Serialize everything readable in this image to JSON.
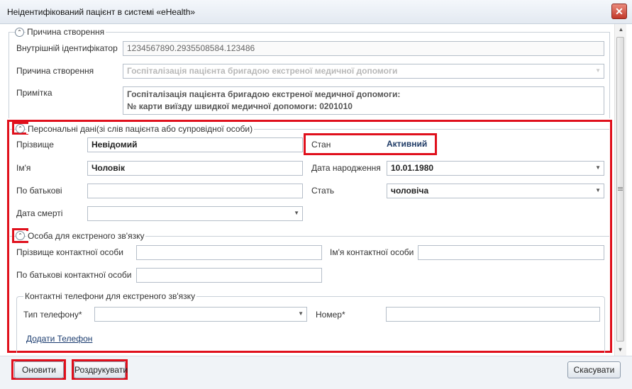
{
  "window": {
    "title": "Неідентифікований пацієнт в системі «eHealth»",
    "close": "✕"
  },
  "section_reason": {
    "legend": "Причина створення",
    "internal_id_label": "Внутрішній ідентифікатор",
    "internal_id_value": "1234567890.2935508584.123486",
    "reason_label": "Причина створення",
    "reason_value": "Госпіталізація пацієнта бригадою екстреної медичної допомоги",
    "note_label": "Примітка",
    "note_line1": "Госпіталізація пацієнта бригадою екстреної медичної допомоги:",
    "note_line2": "№ карти виїзду швидкої медичної допомоги: 0201010"
  },
  "section_personal": {
    "legend": "Персональні дані(зі слів пацієнта або супровідної особи)",
    "surname_label": "Прізвище",
    "surname_value": "Невідомий",
    "status_label": "Стан",
    "status_value": "Активний",
    "name_label": "Ім'я",
    "name_value": "Чоловік",
    "birth_label": "Дата народження",
    "birth_value": "10.01.1980",
    "patronymic_label": "По батькові",
    "patronymic_value": "",
    "sex_label": "Стать",
    "sex_value": "чоловіча",
    "death_label": "Дата смерті",
    "death_value": ""
  },
  "section_contact": {
    "legend": "Особа для екстреного зв'язку",
    "contact_surname_label": "Прізвище контактної особи",
    "contact_name_label": "Ім'я контактної особи",
    "contact_patronymic_label": "По батькові контактної особи",
    "phones_legend": "Контактні телефони для екстреного зв'язку",
    "phone_type_label": "Тип телефону*",
    "number_label": "Номер*",
    "add_phone_link": "Додати Телефон"
  },
  "buttons": {
    "update": "Оновити",
    "print": "Роздрукувати",
    "cancel": "Скасувати"
  },
  "icons": {
    "collapse": "⌃",
    "dropdown": "▼",
    "scroll_up": "▲",
    "scroll_down": "▼"
  },
  "colors": {
    "highlight": "#e0101c",
    "link": "#1a3b6e"
  }
}
